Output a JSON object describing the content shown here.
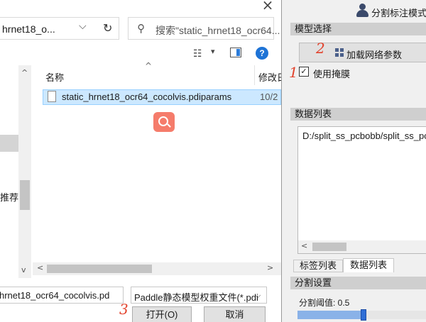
{
  "dialog": {
    "close_glyph": "×",
    "address_text": "hrnet18_o...",
    "search_placeholder": "搜索\"static_hrnet18_ocr64...",
    "nav_partial_text": "推荐/",
    "column_name": "名称",
    "column_date": "修改日",
    "file": {
      "name": "static_hrnet18_ocr64_cocolvis.pdiparams",
      "date": "10/2"
    },
    "filename_value": "hrnet18_ocr64_cocolvis.pd",
    "filetype_value": "Paddle静态模型权重文件(*.pdi",
    "open_label": "打开(O)",
    "cancel_label": "取消",
    "icons": [
      "close-icon",
      "chevron-down-icon",
      "refresh-icon",
      "search-icon",
      "view-options-icon",
      "preview-pane-icon",
      "help-icon",
      "file-icon",
      "search-overlay-icon"
    ]
  },
  "annotations": {
    "step1": "1",
    "step2": "2",
    "step3": "3"
  },
  "app": {
    "mode_label": "分割标注模式",
    "model_section": "模型选择",
    "load_button": "加载网络参数",
    "use_mask_label": "使用掩膜",
    "use_mask_checked": true,
    "data_section": "数据列表",
    "data_item": "D:/split_ss_pcbobb/split_ss_pcb",
    "tab_labels": "标签列表",
    "tab_datalist": "数据列表",
    "seg_section": "分割设置",
    "seg_threshold_label": "分割阈值:  0.5",
    "seg_threshold_value": 0.5
  },
  "colors": {
    "selection": "#cce8ff",
    "help_blue": "#1e73d6",
    "annotation_red": "#e2412b",
    "slider_blue": "#2f6ed6",
    "overlay_button": "#f57c6b"
  }
}
